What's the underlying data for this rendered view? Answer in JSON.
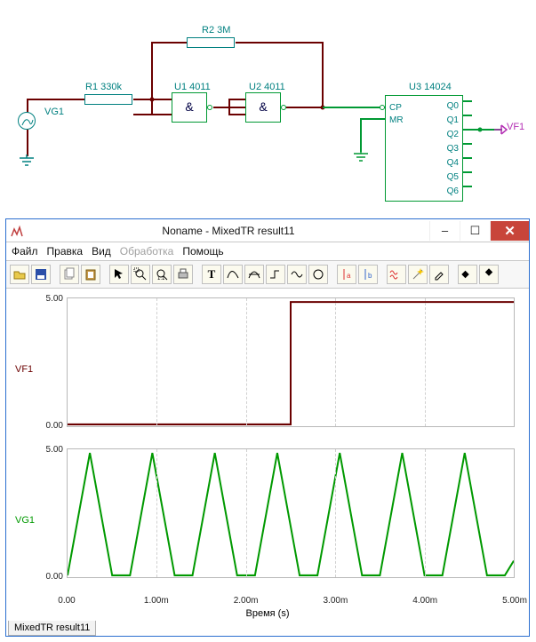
{
  "schematic": {
    "r1": "R1 330k",
    "r2": "R2 3M",
    "u1": "U1 4011",
    "u2": "U2 4011",
    "u3": "U3 14024",
    "vg1": "VG1",
    "vf1": "VF1",
    "gate_symbol": "&",
    "u3_pins": {
      "cp": "CP",
      "mr": "MR",
      "q": [
        "Q0",
        "Q1",
        "Q2",
        "Q3",
        "Q4",
        "Q5",
        "Q6"
      ]
    }
  },
  "window": {
    "title": "Noname - MixedTR result11",
    "buttons": {
      "minimize": "–",
      "maximize": "☐",
      "close": "✕"
    },
    "menu": {
      "file": "Файл",
      "edit": "Правка",
      "view": "Вид",
      "process": "Обработка",
      "help": "Помощь"
    },
    "toolbar_icons": [
      "open",
      "save",
      "copy",
      "paste",
      "pointer",
      "zoom-select",
      "zoom-1to1",
      "printer",
      "text",
      "spline",
      "curve",
      "step",
      "envelope",
      "circle",
      "cursor-a",
      "cursor-b",
      "waves",
      "wand",
      "eyedropper",
      "arrows-lr",
      "arrows-ud"
    ],
    "tab": "MixedTR result11"
  },
  "chart_data": [
    {
      "type": "line",
      "name": "VF1",
      "ylabel": "VF1",
      "ylim": [
        0,
        5
      ],
      "xlim": [
        0,
        0.005
      ],
      "x": [
        0,
        0.0025,
        0.0025,
        0.005
      ],
      "y": [
        0,
        0,
        5,
        5
      ],
      "color": "#6b0000"
    },
    {
      "type": "line",
      "name": "VG1",
      "ylabel": "VG1",
      "ylim": [
        0,
        5
      ],
      "xlim": [
        0,
        0.005
      ],
      "x": [
        0,
        0.00025,
        0.0005,
        0.0007,
        0.00095,
        0.0012,
        0.0014,
        0.00165,
        0.0019,
        0.0021,
        0.00235,
        0.0026,
        0.0028,
        0.00305,
        0.0033,
        0.0035,
        0.00375,
        0.004,
        0.0042,
        0.00445,
        0.0047,
        0.0049,
        0.005
      ],
      "y": [
        0,
        5,
        0,
        0,
        5,
        0,
        0,
        5,
        0,
        0,
        5,
        0,
        0,
        5,
        0,
        0,
        5,
        0,
        0,
        5,
        0,
        0,
        0.6
      ],
      "color": "#009900"
    }
  ],
  "axis": {
    "yticks": [
      "5.00",
      "0.00"
    ],
    "xticks": [
      "0.00",
      "1.00m",
      "2.00m",
      "3.00m",
      "4.00m",
      "5.00m"
    ],
    "xlabel": "Время (s)"
  }
}
